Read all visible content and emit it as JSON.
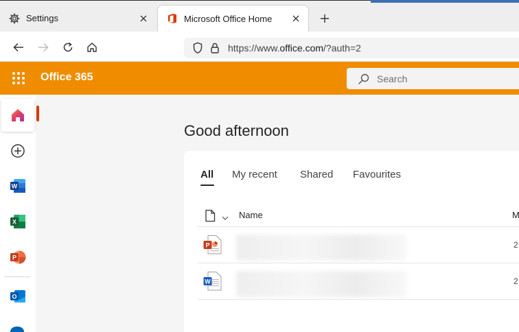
{
  "browser": {
    "tabs": [
      {
        "label": "Settings",
        "icon": "gear-icon",
        "active": false
      },
      {
        "label": "Microsoft Office Home",
        "icon": "office-logo-icon",
        "active": true
      }
    ],
    "address": {
      "prefix": "https://www.",
      "host": "office.com",
      "path": "/?auth=2"
    }
  },
  "office": {
    "app_name": "Office 365",
    "search_placeholder": "Search",
    "header_color": "#f08c00"
  },
  "rail": {
    "items": [
      "home-icon",
      "create-new-icon",
      "word-icon",
      "excel-icon",
      "powerpoint-icon",
      "outlook-icon",
      "onedrive-icon"
    ]
  },
  "main": {
    "greeting": "Good afternoon",
    "filter_tabs": [
      {
        "label": "All",
        "selected": true
      },
      {
        "label": "My recent",
        "selected": false
      },
      {
        "label": "Shared",
        "selected": false
      },
      {
        "label": "Favourites",
        "selected": false
      }
    ],
    "columns": {
      "name": "Name",
      "modified": "M"
    },
    "files": [
      {
        "type": "powerpoint",
        "modified": "2"
      },
      {
        "type": "word",
        "modified": "2"
      }
    ]
  }
}
